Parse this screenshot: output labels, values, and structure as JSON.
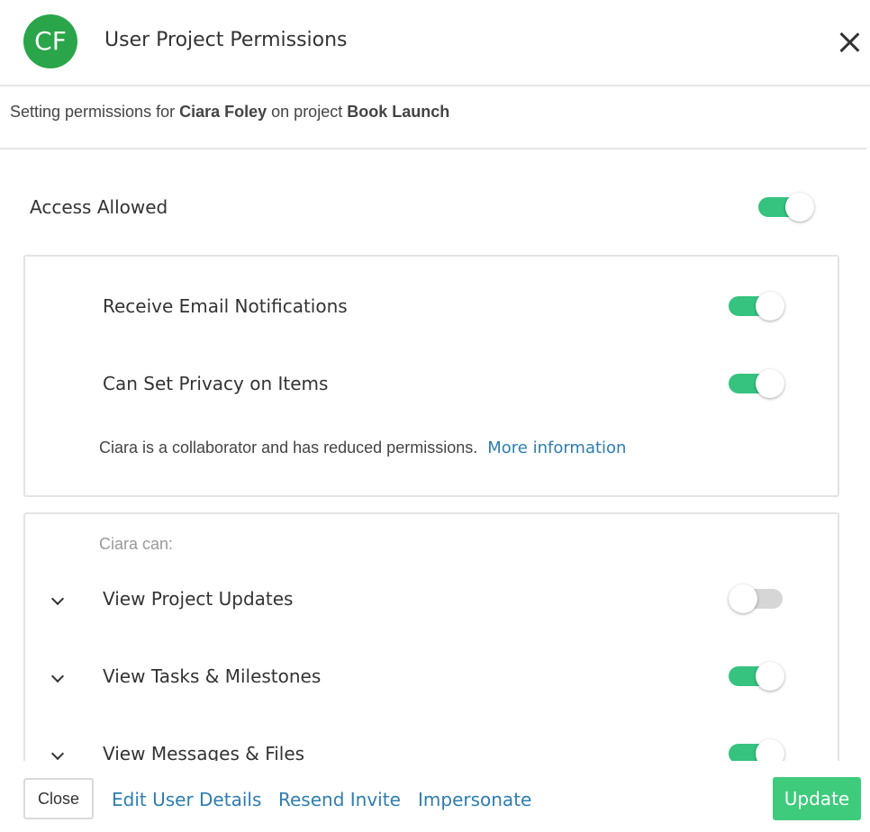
{
  "header": {
    "avatar_initials": "CF",
    "title": "User Project Permissions",
    "close_icon": "close-icon"
  },
  "subtitle": {
    "prefix": "Setting permissions for",
    "user_name": "Ciara Foley",
    "middle": "on project",
    "project_name": "Book Launch"
  },
  "access": {
    "label": "Access Allowed",
    "enabled": true
  },
  "settings_panel": {
    "items": [
      {
        "label": "Receive Email Notifications",
        "enabled": true
      },
      {
        "label": "Can Set Privacy on Items",
        "enabled": true
      }
    ],
    "note": "Ciara is a collaborator and has reduced permissions.",
    "note_link": "More information"
  },
  "capabilities_panel": {
    "heading": "Ciara can:",
    "items": [
      {
        "label": "View Project Updates",
        "enabled": false,
        "icon": "chevron-down-icon"
      },
      {
        "label": "View Tasks & Milestones",
        "enabled": true,
        "icon": "chevron-down-icon"
      },
      {
        "label": "View Messages & Files",
        "enabled": true,
        "icon": "chevron-down-icon"
      }
    ]
  },
  "footer": {
    "close_label": "Close",
    "edit_label": "Edit User Details",
    "resend_label": "Resend Invite",
    "impersonate_label": "Impersonate",
    "update_label": "Update"
  },
  "colors": {
    "avatar": "#2aa54a",
    "toggle_on": "#35c37f",
    "toggle_off": "#d6d6d6",
    "link": "#2e7db0",
    "update_button": "#3ecb7c"
  }
}
